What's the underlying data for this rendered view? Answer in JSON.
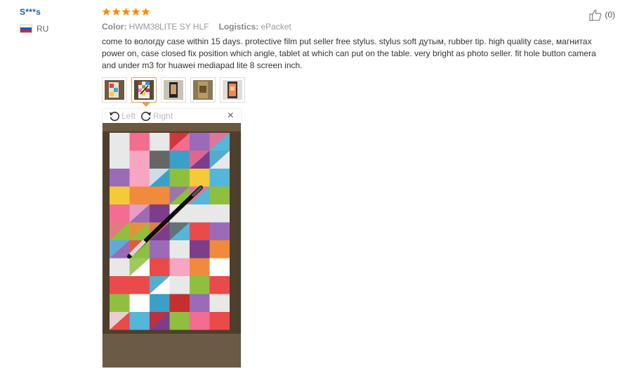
{
  "user": {
    "name": "S***s",
    "country": "RU",
    "flag_colors": [
      "#ffffff",
      "#1c58c6",
      "#d52b1e"
    ]
  },
  "rating": {
    "stars": 5,
    "max": 5,
    "color": "#ff8a00"
  },
  "meta": {
    "color_label": "Color:",
    "color_value": "HWM38LITE SY HLF",
    "logistics_label": "Logistics:",
    "logistics_value": "ePacket"
  },
  "feedback": "come to вологду case within 15 days. protective film put seller free stylus. stylus soft дутым, rubber tip. high quality case, магнитах power on, case closed fix position which angle, tablet at which can put on the table. very bright as photo seller. fit hole button camera and under m3 for huawei mediapad lite 8 screen inch.",
  "thumbnails": {
    "count": 5,
    "active_index": 1
  },
  "viewer": {
    "rotate_left_label": "Left",
    "rotate_right_label": "Right",
    "close_symbol": "×"
  },
  "helpful": {
    "count": "(0)"
  }
}
